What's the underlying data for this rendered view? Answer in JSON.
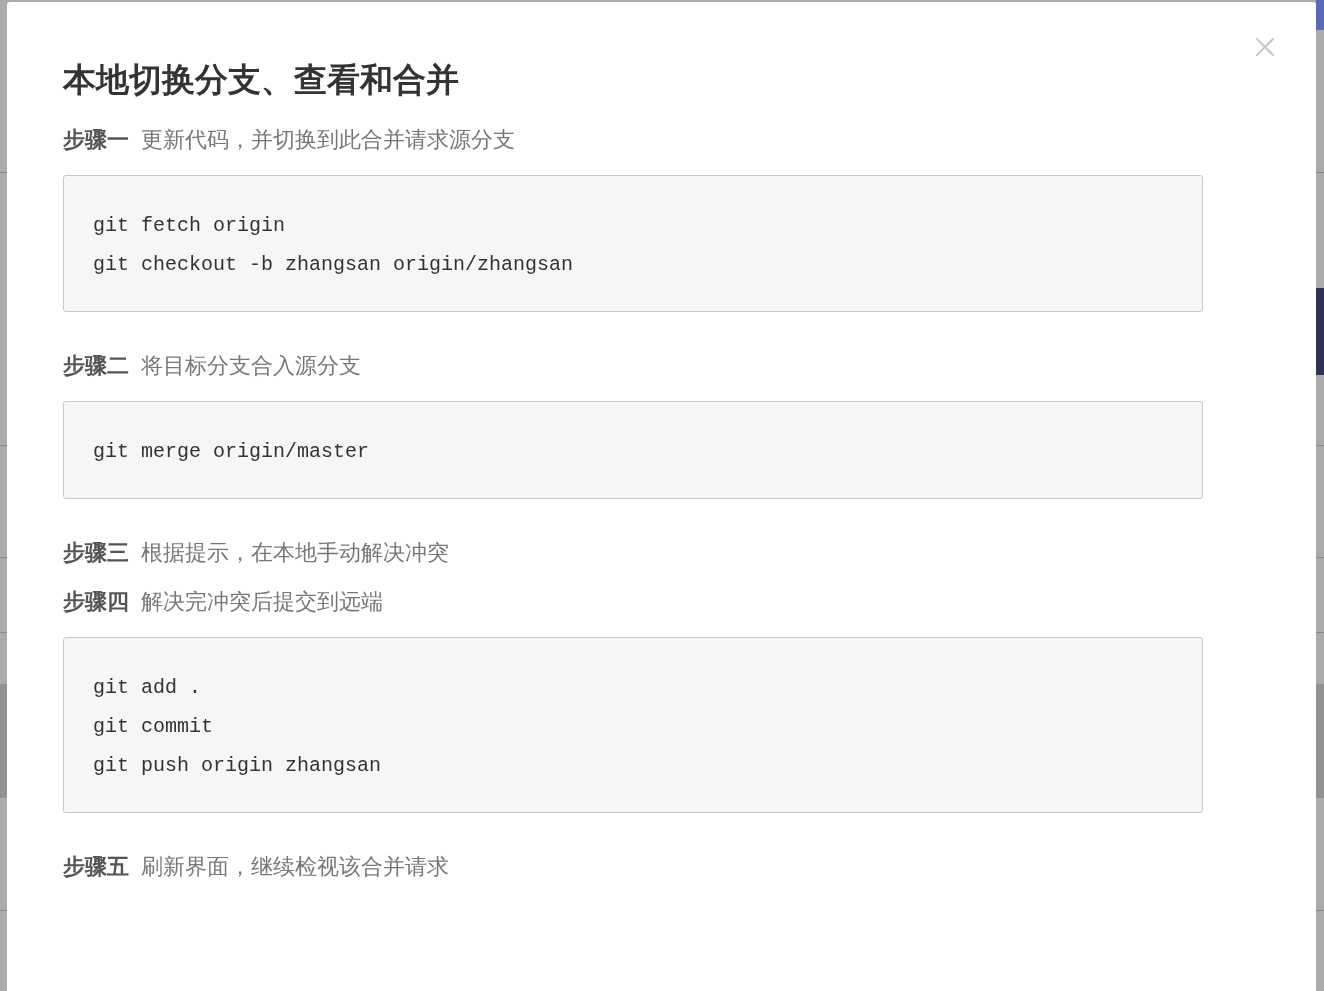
{
  "dialog": {
    "title": "本地切换分支、查看和合并",
    "steps": [
      {
        "label": "步骤一",
        "text": "更新代码，并切换到此合并请求源分支",
        "code": [
          "git fetch origin",
          "git checkout -b zhangsan origin/zhangsan"
        ]
      },
      {
        "label": "步骤二",
        "text": "将目标分支合入源分支",
        "code": [
          "git merge origin/master"
        ]
      },
      {
        "label": "步骤三",
        "text": "根据提示，在本地手动解决冲突"
      },
      {
        "label": "步骤四",
        "text": "解决完冲突后提交到远端",
        "code": [
          "git add .",
          "git commit",
          "git push origin zhangsan"
        ]
      },
      {
        "label": "步骤五",
        "text": "刷新界面，继续检视该合并请求"
      }
    ]
  }
}
